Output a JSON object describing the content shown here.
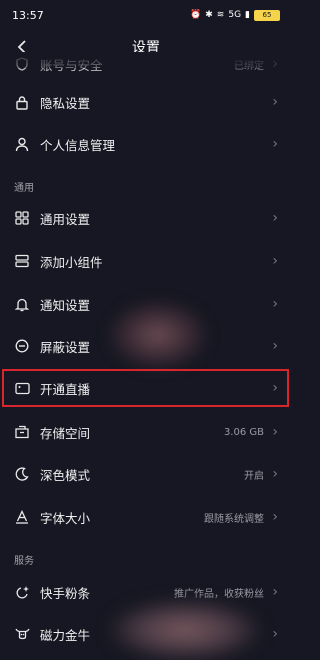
{
  "status_bar": {
    "time": "13:57",
    "signal": "5G",
    "battery": "65"
  },
  "header": {
    "title": "设置"
  },
  "partial_row": {
    "label": "账号与安全",
    "value": "已绑定"
  },
  "rows_top": [
    {
      "label": "隐私设置",
      "icon": "lock-icon"
    },
    {
      "label": "个人信息管理",
      "icon": "person-icon"
    }
  ],
  "sections": {
    "general": "通用",
    "service": "服务"
  },
  "general_rows": [
    {
      "label": "通用设置",
      "icon": "grid-icon",
      "value": ""
    },
    {
      "label": "添加小组件",
      "icon": "widget-icon",
      "value": ""
    },
    {
      "label": "通知设置",
      "icon": "bell-icon",
      "value": ""
    },
    {
      "label": "屏蔽设置",
      "icon": "block-icon",
      "value": ""
    },
    {
      "label": "开通直播",
      "icon": "live-camera-icon",
      "value": ""
    },
    {
      "label": "存储空间",
      "icon": "storage-icon",
      "value": "3.06 GB"
    },
    {
      "label": "深色模式",
      "icon": "moon-icon",
      "value": "开启"
    },
    {
      "label": "字体大小",
      "icon": "font-icon",
      "value": "跟随系统调整"
    }
  ],
  "service_rows": [
    {
      "label": "快手粉条",
      "icon": "sparkle-icon",
      "value": "推广作品，收获粉丝"
    },
    {
      "label": "磁力金牛",
      "icon": "bull-icon",
      "value": ""
    }
  ],
  "colors": {
    "background": "#161722",
    "highlight_border": "#d9262d",
    "battery": "#f5d34a"
  }
}
